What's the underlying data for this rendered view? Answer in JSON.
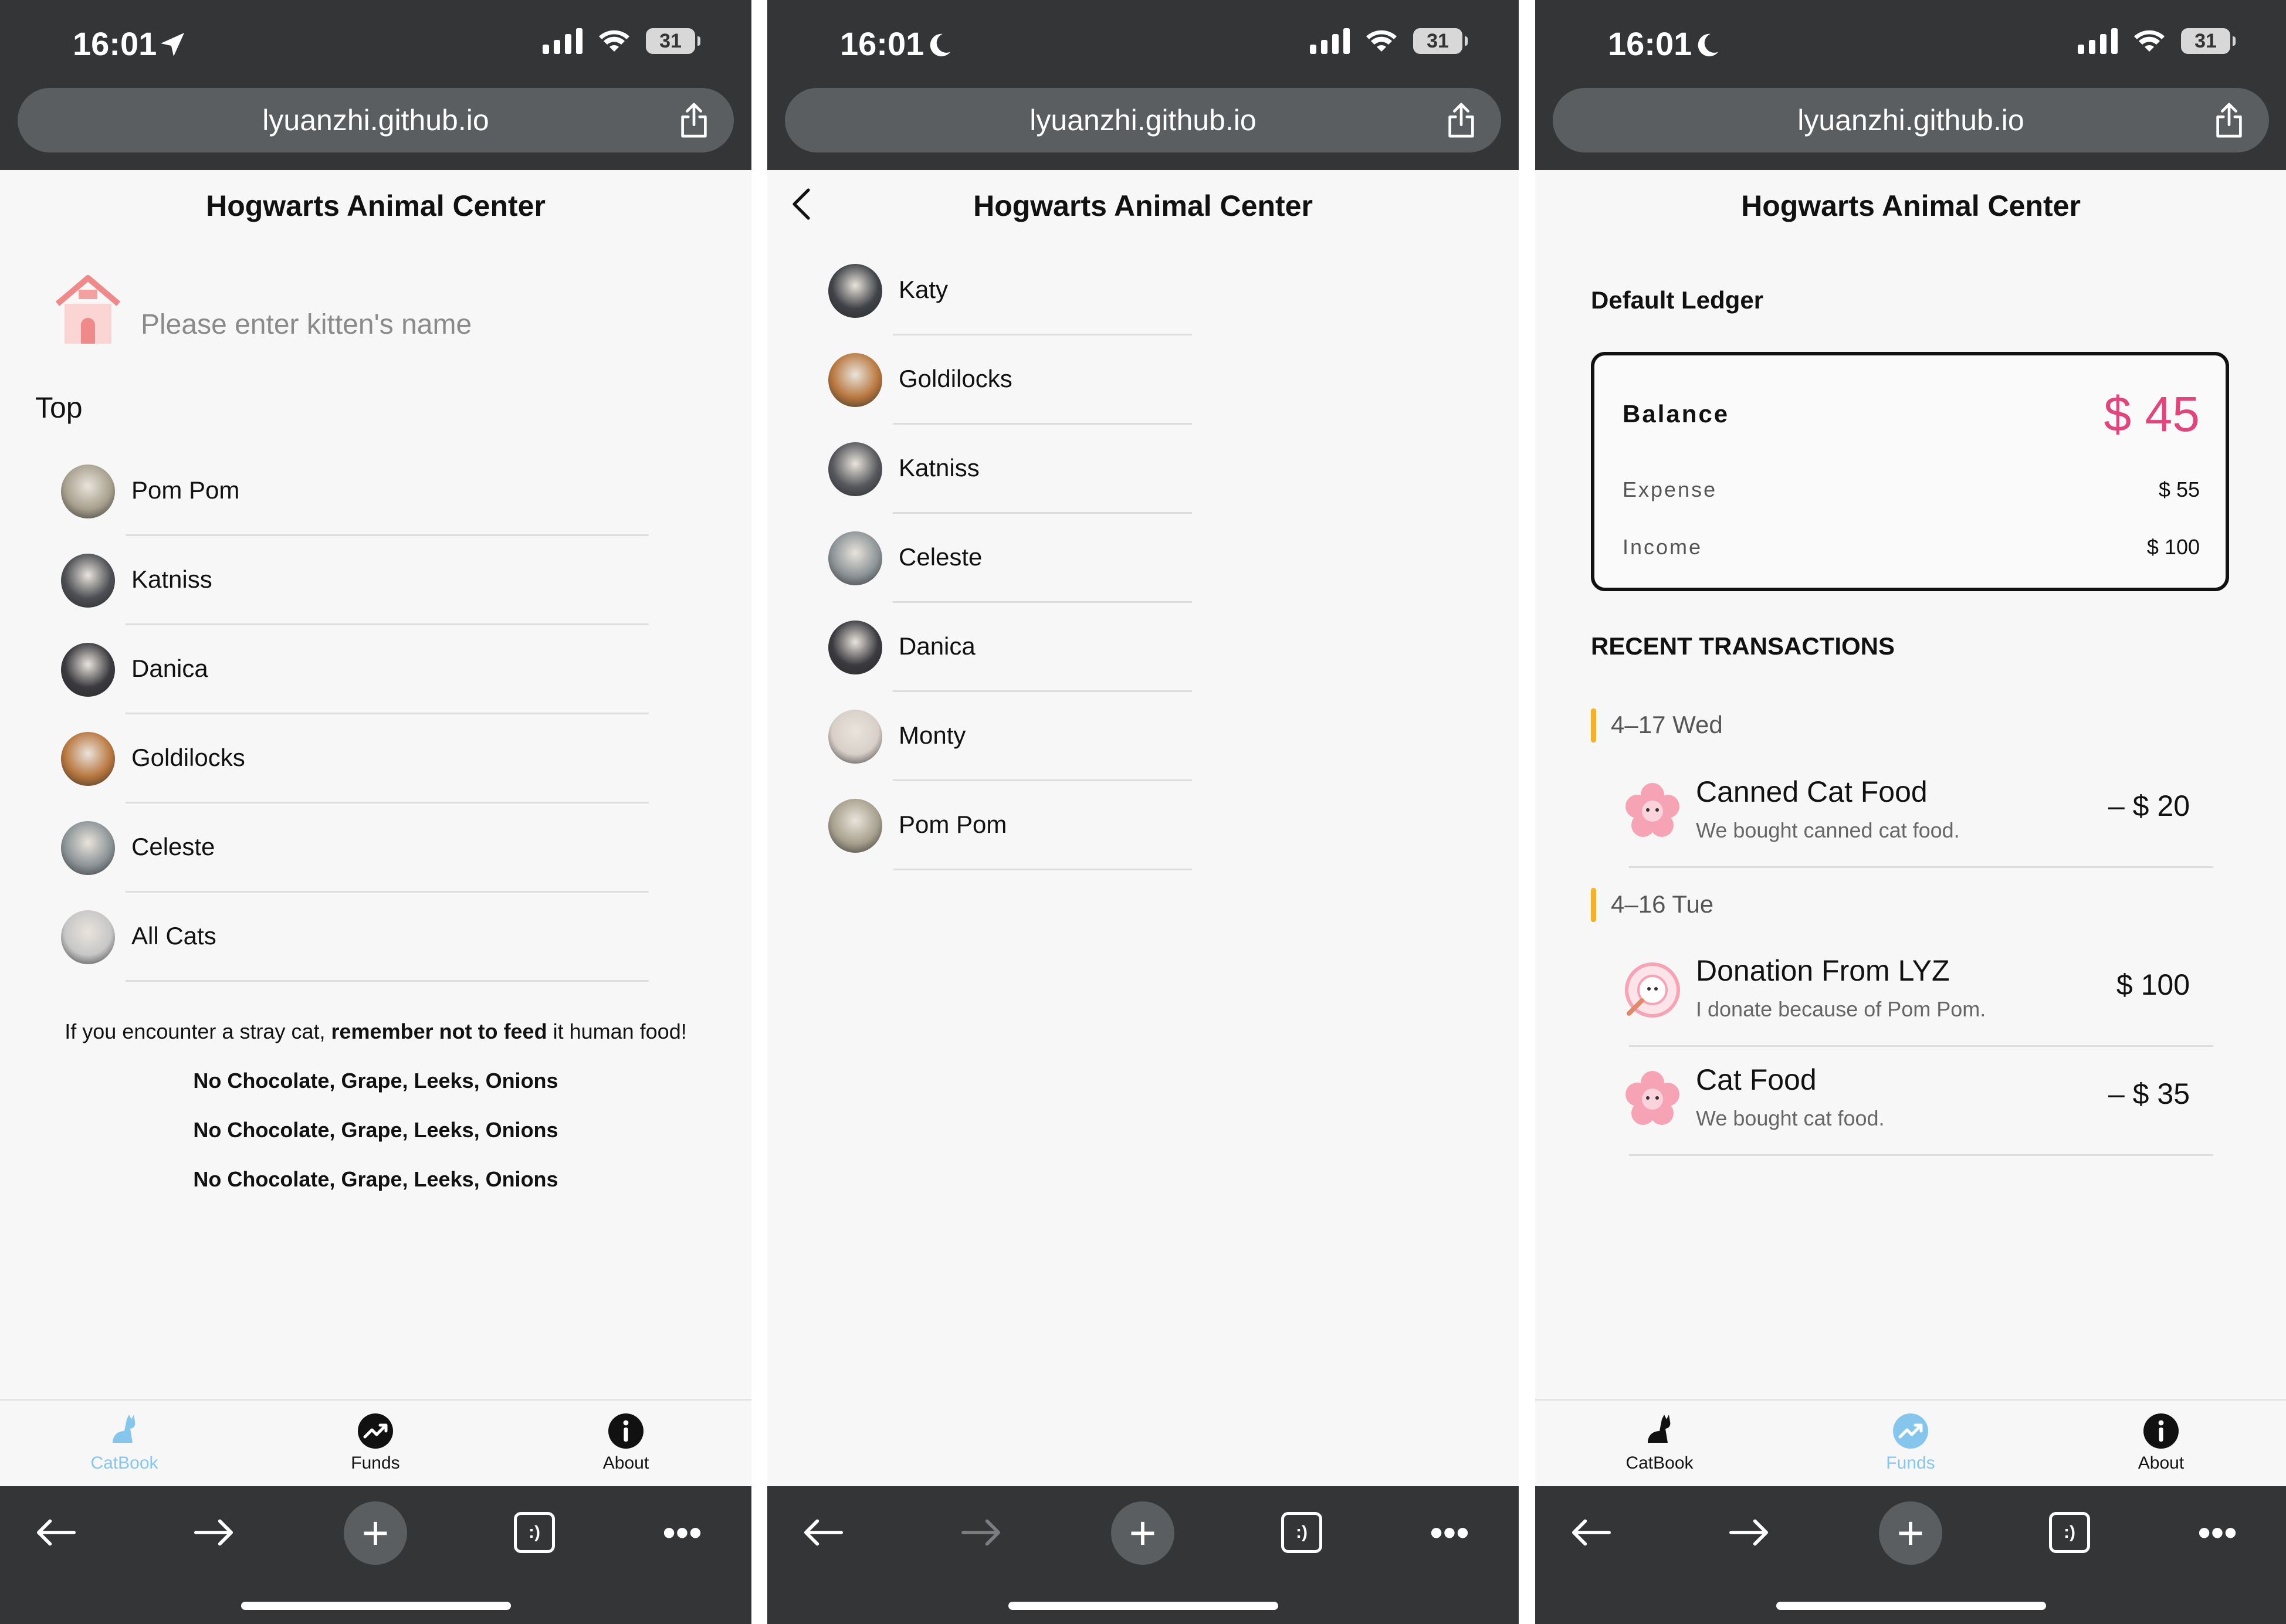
{
  "status": {
    "time": "16:01",
    "battery": "31"
  },
  "browser": {
    "url": "lyuanzhi.github.io",
    "tabs_label": ":)"
  },
  "app": {
    "title": "Hogwarts Animal Center"
  },
  "phone1": {
    "search_placeholder": "Please enter kitten's name",
    "section_label": "Top",
    "list": [
      {
        "name": "Pom Pom",
        "tone": "#a8a08e"
      },
      {
        "name": "Katniss",
        "tone": "#4d4f54"
      },
      {
        "name": "Danica",
        "tone": "#3a3a3f"
      },
      {
        "name": "Goldilocks",
        "tone": "#b9773f"
      },
      {
        "name": "Celeste",
        "tone": "#8c9497"
      },
      {
        "name": "All Cats",
        "tone": "#c7c7c7"
      }
    ],
    "tip_prefix": "If you encounter a stray cat, ",
    "tip_bold": "remember not to feed",
    "tip_suffix": " it human food!",
    "warnings": [
      "No Chocolate, Grape, Leeks, Onions",
      "No Chocolate, Grape, Leeks, Onions",
      "No Chocolate, Grape, Leeks, Onions"
    ]
  },
  "phone2": {
    "list": [
      {
        "name": "Katy",
        "tone": "#3f4247"
      },
      {
        "name": "Goldilocks",
        "tone": "#b9773f"
      },
      {
        "name": "Katniss",
        "tone": "#55575c"
      },
      {
        "name": "Celeste",
        "tone": "#8c9497"
      },
      {
        "name": "Danica",
        "tone": "#3a3a3f"
      },
      {
        "name": "Monty",
        "tone": "#d9cfc9"
      },
      {
        "name": "Pom Pom",
        "tone": "#a8a08e"
      }
    ]
  },
  "phone3": {
    "ledger_title": "Default Ledger",
    "balance_label": "Balance",
    "balance_value": "$ 45",
    "expense_label": "Expense",
    "expense_value": "$ 55",
    "income_label": "Income",
    "income_value": "$ 100",
    "recent_title": "RECENT TRANSACTIONS",
    "dates": [
      "4–17  Wed",
      "4–16  Tue"
    ],
    "transactions": [
      {
        "title": "Canned Cat Food",
        "desc": "We bought canned cat food.",
        "amount": "– $ 20"
      },
      {
        "title": "Donation From LYZ",
        "desc": "I donate because of Pom Pom.",
        "amount": "$ 100"
      },
      {
        "title": "Cat Food",
        "desc": "We bought cat food.",
        "amount": "– $ 35"
      }
    ]
  },
  "tabbar": {
    "catbook": "CatBook",
    "funds": "Funds",
    "about": "About"
  },
  "colors": {
    "accent_pink": "#e0457b",
    "tab_active": "#87c6ec",
    "date_marker": "#f4b12c",
    "chrome": "#333537"
  },
  "icons": [
    "location-arrow-icon",
    "moon-icon",
    "signal-icon",
    "wifi-icon",
    "battery-icon",
    "share-icon",
    "back-arrow-icon",
    "forward-arrow-icon",
    "plus-icon",
    "tabs-icon",
    "more-icon",
    "cat-icon",
    "funds-icon",
    "info-icon",
    "house-icon",
    "flower-icon",
    "chevron-left-icon"
  ]
}
